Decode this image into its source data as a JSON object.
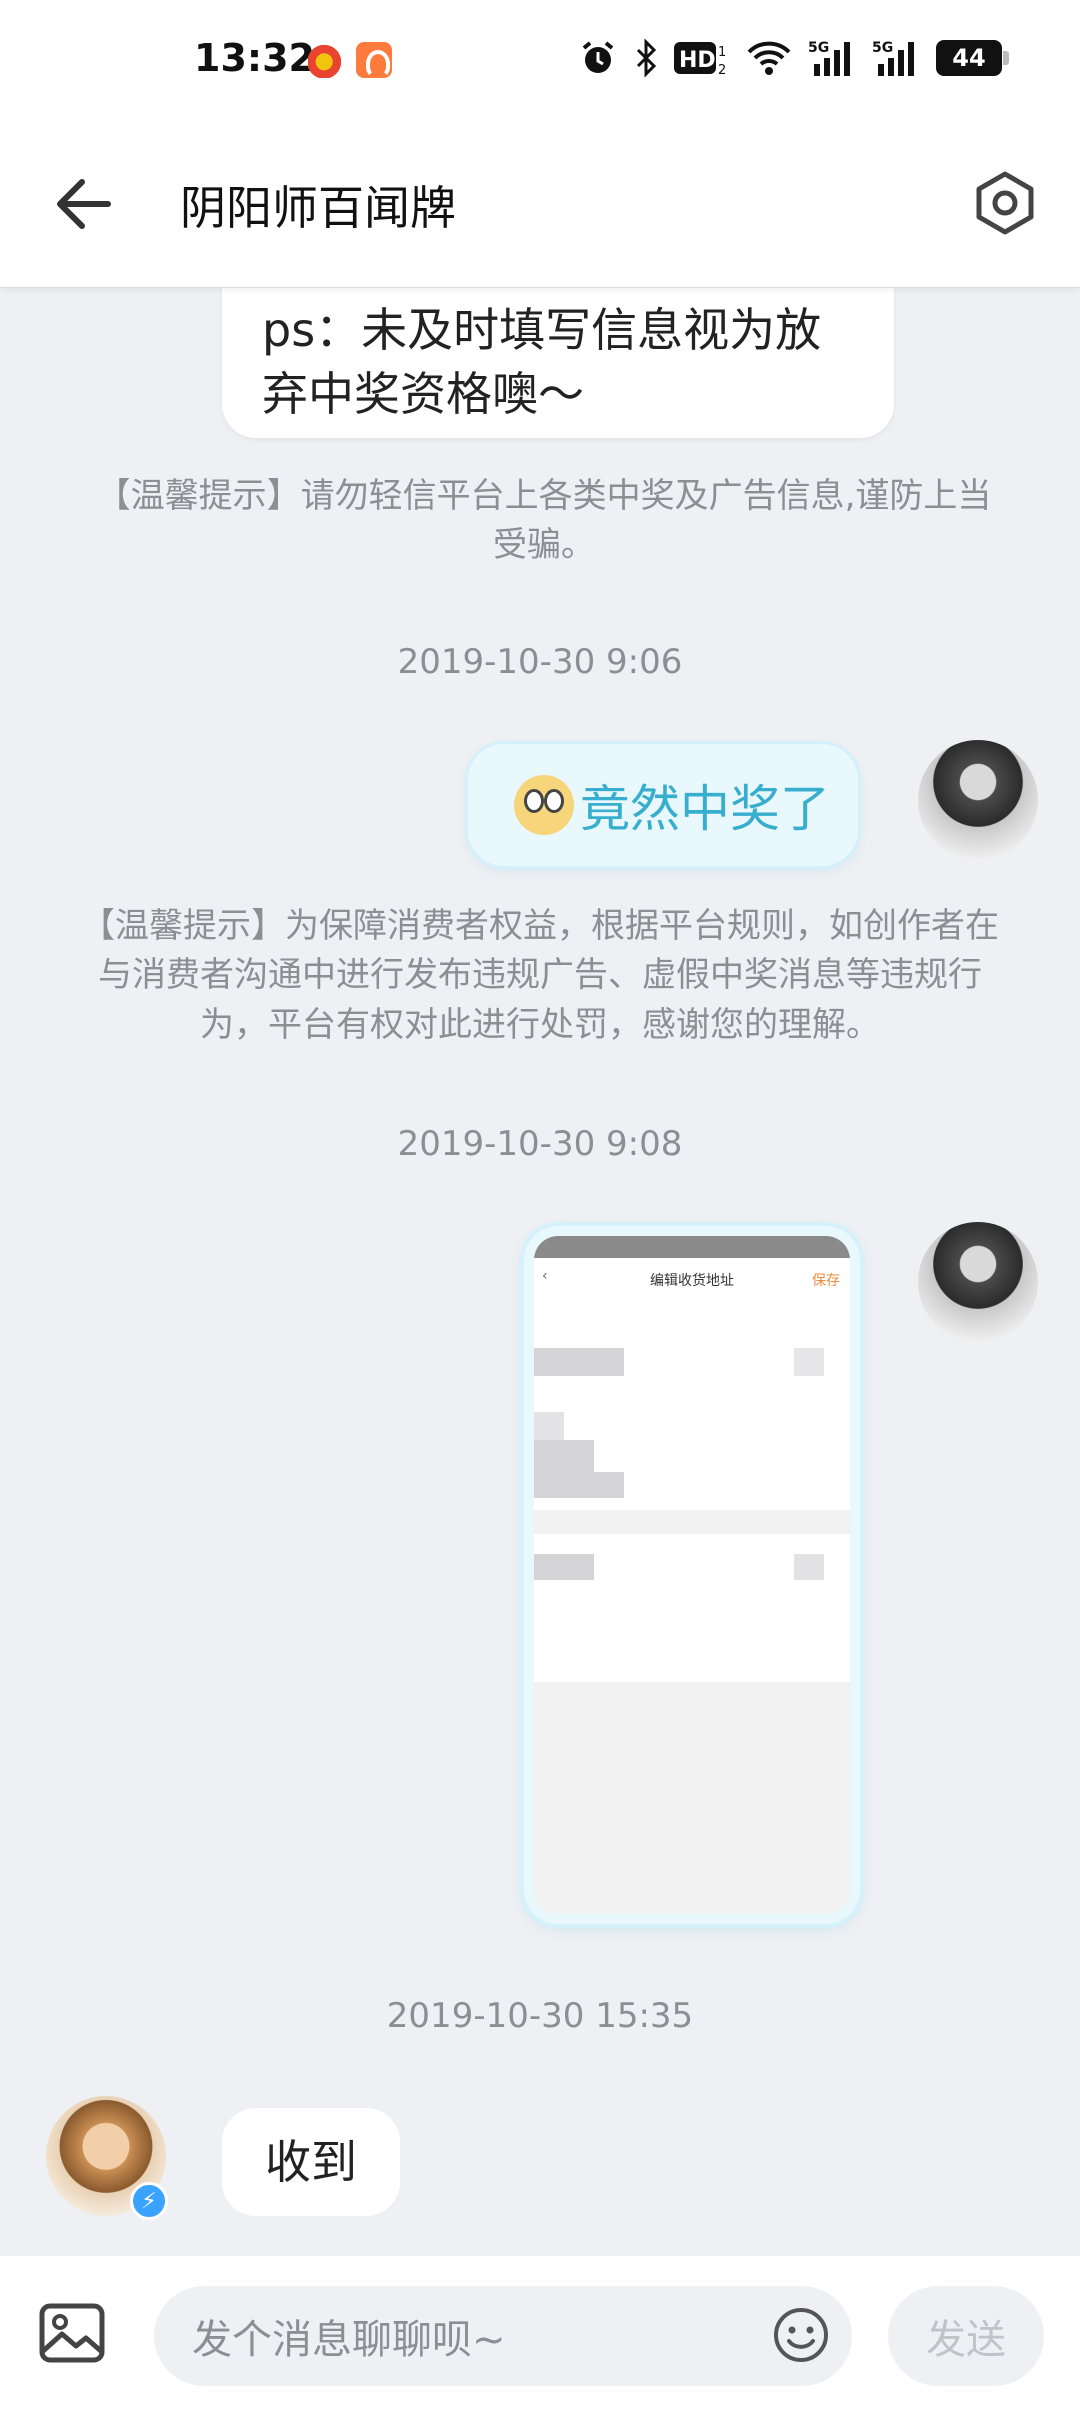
{
  "status_bar": {
    "time": "13:32",
    "battery": "44",
    "icons": [
      "weibo-icon",
      "app-icon",
      "alarm-icon",
      "bluetooth-icon",
      "hd-icon",
      "wifi-icon",
      "signal-5g-icon",
      "signal-5g-icon",
      "battery-icon"
    ]
  },
  "header": {
    "title": "阴阳师百闻牌",
    "back_icon": "arrow-left-icon",
    "settings_icon": "hexagon-settings-icon"
  },
  "messages": [
    {
      "type": "text",
      "side": "left",
      "text": "ps：未及时填写信息视为放弃中奖资格噢～"
    },
    {
      "type": "tip",
      "text": "【温馨提示】请勿轻信平台上各类中奖及广告信息,谨防上当受骗。"
    },
    {
      "type": "time",
      "text": "2019-10-30 9:06"
    },
    {
      "type": "sticker",
      "side": "right",
      "text": "竟然中奖了"
    },
    {
      "type": "tip",
      "text": "【温馨提示】为保障消费者权益，根据平台规则，如创作者在与消费者沟通中进行发布违规广告、虚假中奖消息等违规行为，平台有权对此进行处罚，感谢您的理解。"
    },
    {
      "type": "time",
      "text": "2019-10-30 9:08"
    },
    {
      "type": "image",
      "side": "right",
      "screenshot_title": "编辑收货地址",
      "screenshot_save": "保存"
    },
    {
      "type": "time",
      "text": "2019-10-30 15:35"
    },
    {
      "type": "text",
      "side": "left",
      "text": "收到"
    }
  ],
  "input_bar": {
    "placeholder": "发个消息聊聊呗~",
    "send_label": "发送"
  },
  "colors": {
    "background": "#eef0f3",
    "sticker_text": "#37aecd",
    "bubble": "#ffffff",
    "muted": "#8b8f95"
  }
}
